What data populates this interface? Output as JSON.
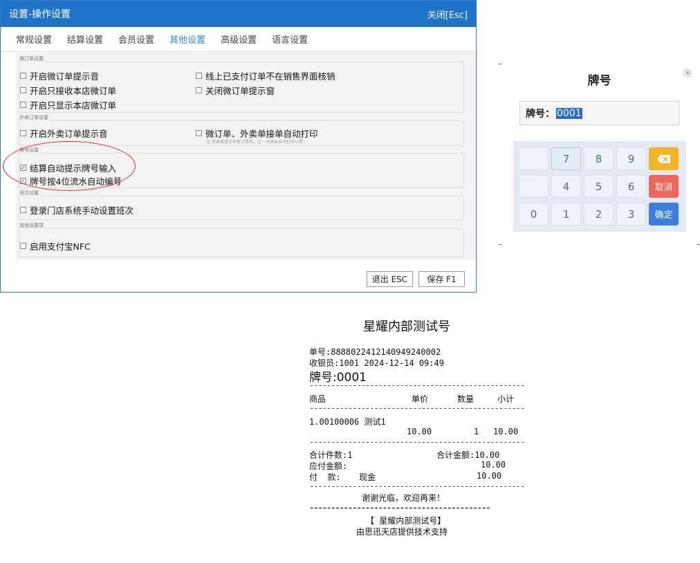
{
  "dialog": {
    "title": "设置-操作设置",
    "close_label": "关闭[Esc]",
    "tabs": [
      "常规设置",
      "结算设置",
      "会员设置",
      "其他设置",
      "高级设置",
      "语言设置"
    ],
    "active_tab": "其他设置",
    "groups": {
      "micro_order": {
        "label": "微订单设置",
        "options": [
          {
            "label": "开启微订单提示音",
            "checked": false
          },
          {
            "label": "线上已支付订单不在销售界面核销",
            "checked": false
          },
          {
            "label": "开启只接收本店微订单",
            "checked": false
          },
          {
            "label": "关闭微订单提示窗",
            "checked": false
          },
          {
            "label": "开启只显示本店微订单",
            "checked": false
          }
        ]
      },
      "takeout": {
        "label": "外卖订单设置",
        "options": [
          {
            "label": "开启外卖订单提示音",
            "checked": false
          },
          {
            "label": "微订单、外卖单接单自动打印",
            "checked": false
          }
        ],
        "hint": "注:若自接提示有新订单后，过一分钟会自动打印小票"
      },
      "plate": {
        "label": "牌号设置",
        "options": [
          {
            "label": "结算自动提示牌号输入",
            "checked": true
          },
          {
            "label": "牌号按4位流水自动编号",
            "checked": true
          }
        ]
      },
      "shift": {
        "label": "班次设置",
        "options": [
          {
            "label": "登录门店系统手动设置班次",
            "checked": false
          }
        ]
      },
      "other": {
        "label": "其他设置项",
        "options": [
          {
            "label": "启用支付宝NFC",
            "checked": false
          }
        ]
      }
    },
    "buttons": {
      "exit": "退出 ESC",
      "save": "保存 F1"
    },
    "check_mark": "✓",
    "highlight_color": "#e0232c"
  },
  "keypad": {
    "title": "牌号",
    "close_icon": "×",
    "field_label": "牌号：",
    "field_value": "0001",
    "keys": {
      "k7": "7",
      "k8": "8",
      "k9": "9",
      "k4": "4",
      "k5": "5",
      "k6": "6",
      "k0": "0",
      "k1": "1",
      "k2": "2",
      "k3": "3",
      "cancel": "取消",
      "ok": "确定"
    },
    "colors": {
      "delete": "#f5b326",
      "cancel": "#f2655a",
      "ok": "#3a7ee0"
    }
  },
  "receipt": {
    "store": "星耀内部测试号",
    "order_no": "单号:8888022412140949240002",
    "cashier": "收银员:1001 2024-12-14 09:49",
    "plate": "牌号:0001",
    "header": {
      "item": "商品",
      "price": "单价",
      "qty": "数量",
      "subtotal": "小计"
    },
    "item_line": "1.00100006 测试1",
    "item_values": {
      "price": "10.00",
      "qty": "1",
      "subtotal": "10.00"
    },
    "total_count": "合计件数:1",
    "total_amount": "合计金额:10.00",
    "payable_label": "应付金额:",
    "payable_value": "10.00",
    "payment_label": "付  款:",
    "payment_method": "现金",
    "payment_value": "10.00",
    "thanks": "谢谢光临，欢迎再来！",
    "footer_store": "【 星耀内部测试号】",
    "footer_support": "由思迅天店提供技术支持",
    "dash": "--------------------------------------------------",
    "dash_heavy": "------------------------------------------"
  }
}
